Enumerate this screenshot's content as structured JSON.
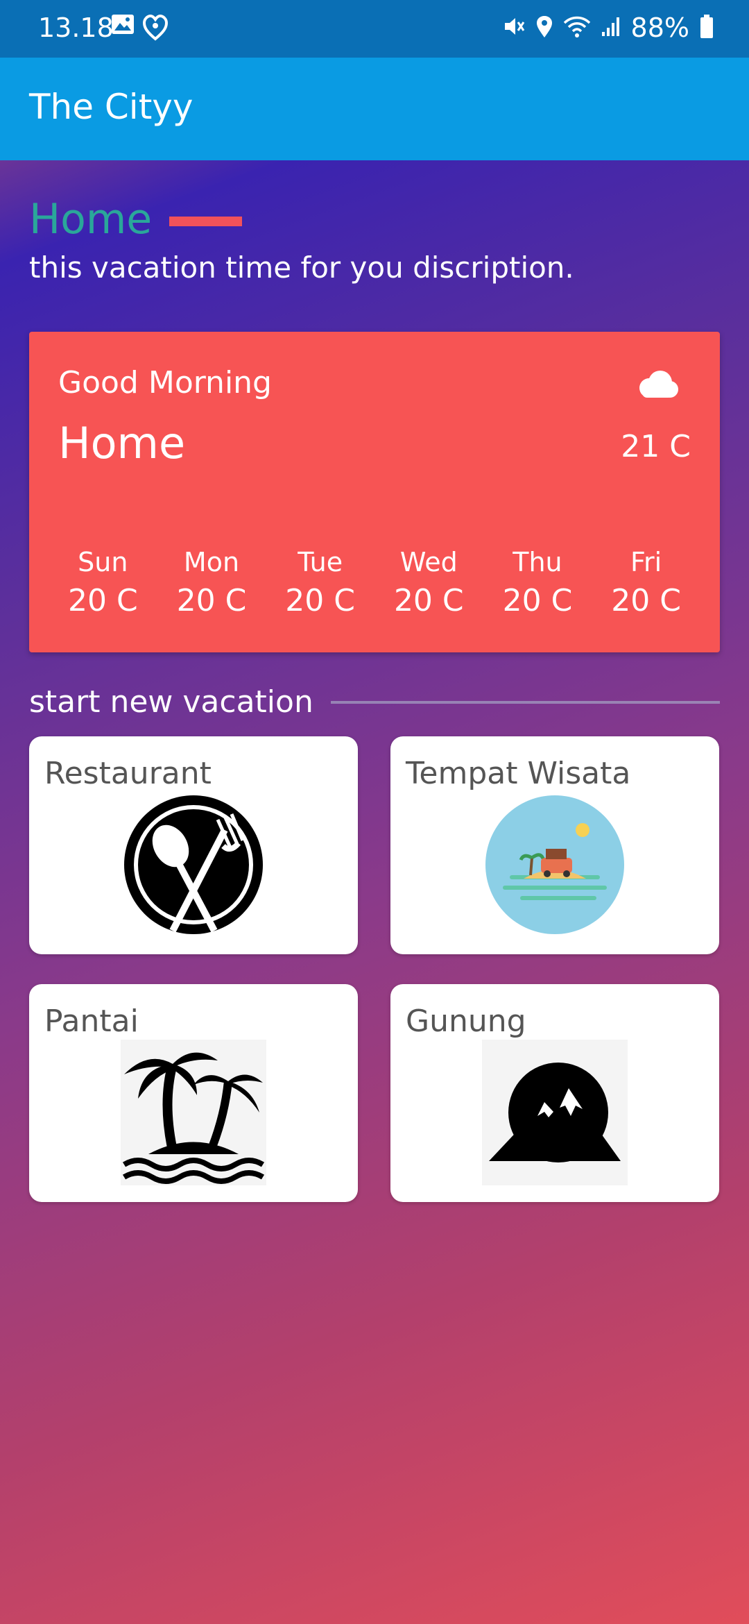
{
  "status_bar": {
    "time": "13.18",
    "battery": "88%",
    "icons": [
      "image-icon",
      "heart-icon",
      "mute-icon",
      "location-icon",
      "wifi-icon",
      "signal-icon",
      "battery-icon"
    ]
  },
  "app_bar": {
    "title": "The Cityy"
  },
  "page": {
    "title": "Home",
    "subtitle": "this vacation time for you discription."
  },
  "weather": {
    "greeting": "Good Morning",
    "location": "Home",
    "current_temp": "21 C",
    "icon": "cloud-icon",
    "forecast": [
      {
        "day": "Sun",
        "temp": "20 C"
      },
      {
        "day": "Mon",
        "temp": "20 C"
      },
      {
        "day": "Tue",
        "temp": "20 C"
      },
      {
        "day": "Wed",
        "temp": "20 C"
      },
      {
        "day": "Thu",
        "temp": "20 C"
      },
      {
        "day": "Fri",
        "temp": "20 C"
      }
    ]
  },
  "section": {
    "title": "start new vacation"
  },
  "categories": [
    {
      "label": "Restaurant",
      "icon": "restaurant-icon"
    },
    {
      "label": "Tempat Wisata",
      "icon": "beach-scene-icon"
    },
    {
      "label": "Pantai",
      "icon": "palm-island-icon"
    },
    {
      "label": "Gunung",
      "icon": "mountain-icon"
    }
  ],
  "colors": {
    "status_bar": "#0a6fb5",
    "app_bar": "#0a9be3",
    "weather_card": "#f75454",
    "title_accent": "#f2525a",
    "page_title": "#2aa79a"
  }
}
